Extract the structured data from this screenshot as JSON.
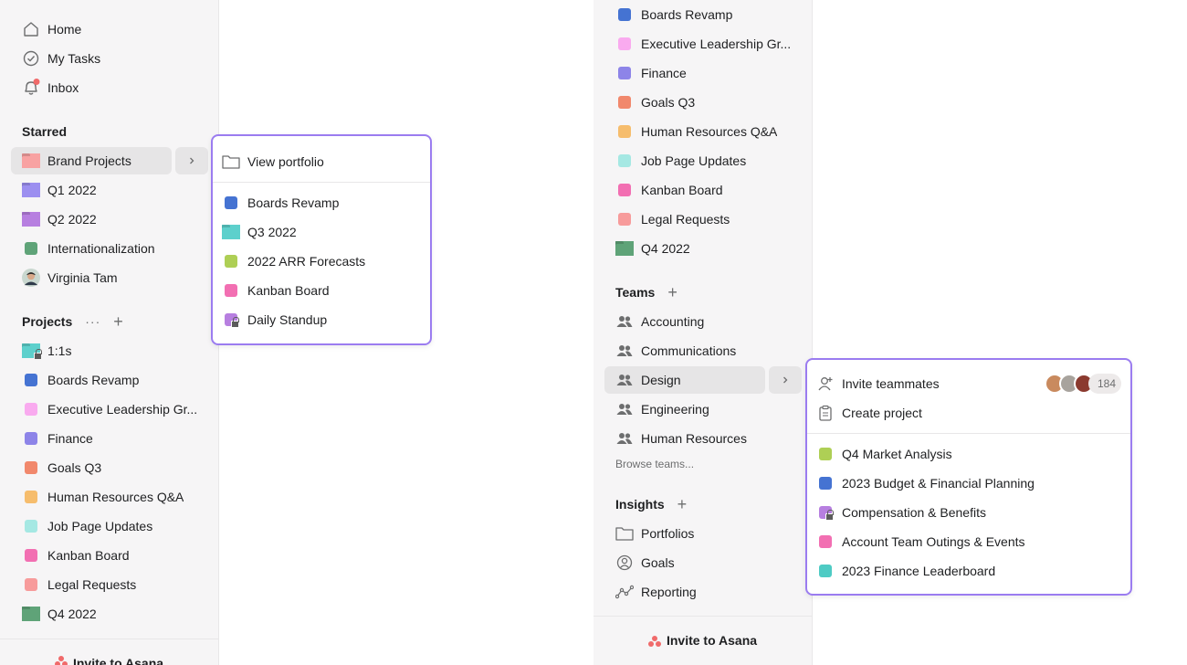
{
  "left_sidebar": {
    "nav": [
      {
        "label": "Home",
        "icon": "home-icon"
      },
      {
        "label": "My Tasks",
        "icon": "check-circle-icon"
      },
      {
        "label": "Inbox",
        "icon": "bell-icon"
      }
    ],
    "starred_title": "Starred",
    "starred": [
      {
        "label": "Brand Projects",
        "icon": "folder",
        "color": "#f8a2a2"
      },
      {
        "label": "Q1 2022",
        "icon": "folder",
        "color": "#9c8ff0"
      },
      {
        "label": "Q2 2022",
        "icon": "folder",
        "color": "#b77fe0"
      },
      {
        "label": "Internationalization",
        "icon": "square",
        "color": "#5fa378"
      },
      {
        "label": "Virginia Tam",
        "icon": "avatar"
      }
    ],
    "projects_title": "Projects",
    "projects": [
      {
        "label": "1:1s",
        "icon": "folder-lock",
        "color": "#5dd0cc"
      },
      {
        "label": "Boards Revamp",
        "icon": "square",
        "color": "#4573d2"
      },
      {
        "label": "Executive Leadership Gr...",
        "icon": "square",
        "color": "#f9aaef"
      },
      {
        "label": "Finance",
        "icon": "square",
        "color": "#8d84e8"
      },
      {
        "label": "Goals Q3",
        "icon": "square",
        "color": "#f1886c"
      },
      {
        "label": "Human Resources Q&A",
        "icon": "square",
        "color": "#f6bd6d"
      },
      {
        "label": "Job Page Updates",
        "icon": "square",
        "color": "#a5e8e3"
      },
      {
        "label": "Kanban Board",
        "icon": "square",
        "color": "#f26fb2"
      },
      {
        "label": "Legal Requests",
        "icon": "square",
        "color": "#f79b9b"
      },
      {
        "label": "Q4 2022",
        "icon": "folder",
        "color": "#5fa378"
      }
    ],
    "invite_label": "Invite to Asana"
  },
  "portfolio_popup": {
    "view_label": "View portfolio",
    "items": [
      {
        "label": "Boards Revamp",
        "icon": "square",
        "color": "#4573d2"
      },
      {
        "label": "Q3 2022",
        "icon": "folder",
        "color": "#5dd0cc"
      },
      {
        "label": "2022 ARR Forecasts",
        "icon": "square",
        "color": "#aecf55"
      },
      {
        "label": "Kanban Board",
        "icon": "square",
        "color": "#f26fb2"
      },
      {
        "label": "Daily Standup",
        "icon": "square-lock",
        "color": "#b77fe0"
      }
    ]
  },
  "right_sidebar": {
    "projects": [
      {
        "label": "Boards Revamp",
        "icon": "square",
        "color": "#4573d2"
      },
      {
        "label": "Executive Leadership Gr...",
        "icon": "square",
        "color": "#f9aaef"
      },
      {
        "label": "Finance",
        "icon": "square",
        "color": "#8d84e8"
      },
      {
        "label": "Goals Q3",
        "icon": "square",
        "color": "#f1886c"
      },
      {
        "label": "Human Resources Q&A",
        "icon": "square",
        "color": "#f6bd6d"
      },
      {
        "label": "Job Page Updates",
        "icon": "square",
        "color": "#a5e8e3"
      },
      {
        "label": "Kanban Board",
        "icon": "square",
        "color": "#f26fb2"
      },
      {
        "label": "Legal Requests",
        "icon": "square",
        "color": "#f79b9b"
      },
      {
        "label": "Q4 2022",
        "icon": "folder",
        "color": "#5fa378"
      }
    ],
    "teams_title": "Teams",
    "teams": [
      "Accounting",
      "Communications",
      "Design",
      "Engineering",
      "Human Resources"
    ],
    "browse_label": "Browse teams...",
    "insights_title": "Insights",
    "insights": [
      {
        "label": "Portfolios",
        "icon": "folder-outline-icon"
      },
      {
        "label": "Goals",
        "icon": "person-icon"
      },
      {
        "label": "Reporting",
        "icon": "line-chart-icon"
      }
    ],
    "invite_label": "Invite to Asana"
  },
  "team_popup": {
    "invite_label": "Invite teammates",
    "member_count": "184",
    "create_label": "Create project",
    "items": [
      {
        "label": "Q4 Market Analysis",
        "icon": "square",
        "color": "#aecf55"
      },
      {
        "label": "2023 Budget & Financial Planning",
        "icon": "square",
        "color": "#4573d2"
      },
      {
        "label": "Compensation & Benefits",
        "icon": "square-lock",
        "color": "#b77fe0"
      },
      {
        "label": "Account Team Outings & Events",
        "icon": "square",
        "color": "#f26fb2"
      },
      {
        "label": "2023 Finance Leaderboard",
        "icon": "square",
        "color": "#4ecbc4"
      }
    ]
  },
  "colors": {
    "popup_border": "#9b7cf0",
    "inbox_dot": "#f06a6a"
  }
}
